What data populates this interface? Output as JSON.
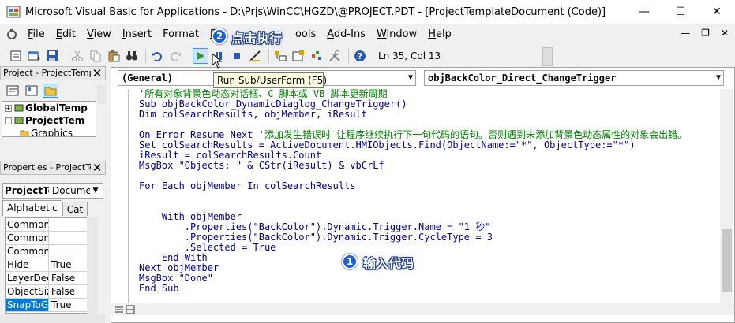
{
  "window": {
    "title": "Microsoft Visual Basic for Applications - D:\\Prjs\\WinCC\\HGZD\\@PROJECT.PDT - [ProjectTemplateDocument (Code)]",
    "minimize": "—",
    "maximize": "☐",
    "close": "✕"
  },
  "menu": {
    "items": [
      {
        "key": "F",
        "rest": "ile"
      },
      {
        "key": "E",
        "rest": "dit"
      },
      {
        "key": "V",
        "rest": "iew"
      },
      {
        "key": "I",
        "rest": "nsert"
      },
      {
        "key": "",
        "rest": "Format"
      },
      {
        "key": "D",
        "rest": ""
      },
      {
        "key": "T",
        "rest": "ools"
      },
      {
        "key": "A",
        "rest": "dd-Ins"
      },
      {
        "key": "W",
        "rest": "indow"
      },
      {
        "key": "H",
        "rest": "elp"
      }
    ],
    "mdi_minimize": "—",
    "mdi_restore": "❐",
    "mdi_close": "✕"
  },
  "toolbar": {
    "position": "Ln 35, Col 13",
    "run_tooltip": "Run Sub/UserForm (F5)"
  },
  "project_panel": {
    "title": "Project - ProjectTemp",
    "close": "✕",
    "tree": [
      {
        "expander": "+",
        "label": "GlobalTemp",
        "bold": true
      },
      {
        "expander": "−",
        "label": "ProjectTem",
        "bold": true
      },
      {
        "expander": "",
        "label": "Graphics",
        "bold": false
      }
    ]
  },
  "properties_panel": {
    "title": "Properties - ProjectTe",
    "close": "✕",
    "object_name": "ProjectTe",
    "object_type": "Documen",
    "tabs": [
      "Alphabetic",
      "Cat"
    ],
    "rows": [
      {
        "name": "CommonV",
        "value": ""
      },
      {
        "name": "CommonV",
        "value": ""
      },
      {
        "name": "CommonV",
        "value": ""
      },
      {
        "name": "Hide",
        "value": "True"
      },
      {
        "name": "LayerDecl",
        "value": "False"
      },
      {
        "name": "ObjectSiz",
        "value": "False"
      },
      {
        "name": "SnapToG",
        "value": "True"
      }
    ]
  },
  "code_window": {
    "object_combo": "(General)",
    "proc_combo": "objBackColor_Direct_ChangeTrigger",
    "lines": [
      {
        "text": "'所有对象背景色动态对话框、C 脚本或 VB 脚本更新周期",
        "kind": "comment"
      },
      {
        "text": "Sub objBackColor_DynamicDiaglog_ChangeTrigger()",
        "kind": "navy"
      },
      {
        "text": "Dim colSearchResults, objMember, iResult",
        "kind": "navy"
      },
      {
        "text": "",
        "kind": "navy"
      },
      {
        "text": "On Error Resume Next '添加发生错误时 让程序继续执行下一句代码的语句。否则遇到未添加背景色动态属性的对象会出错。",
        "kind": "mixed",
        "code": "On Error Resume Next ",
        "comment": "'添加发生错误时 让程序继续执行下一句代码的语句。否则遇到未添加背景色动态属性的对象会出错。"
      },
      {
        "text": "Set colSearchResults = ActiveDocument.HMIObjects.Find(ObjectName:=\"*\", ObjectType:=\"*\")",
        "kind": "navy"
      },
      {
        "text": "iResult = colSearchResults.Count",
        "kind": "navy"
      },
      {
        "text": "MsgBox \"Objects: \" & CStr(iResult) & vbCrLf",
        "kind": "navy"
      },
      {
        "text": "",
        "kind": "navy"
      },
      {
        "text": "For Each objMember In colSearchResults",
        "kind": "navy"
      },
      {
        "text": "",
        "kind": "navy"
      },
      {
        "text": "",
        "kind": "navy"
      },
      {
        "text": "    With objMember",
        "kind": "navy"
      },
      {
        "text": "        .Properties(\"BackColor\").Dynamic.Trigger.Name = \"1 秒\"",
        "kind": "navy"
      },
      {
        "text": "        .Properties(\"BackColor\").Dynamic.Trigger.CycleType = 3",
        "kind": "navy"
      },
      {
        "text": "        .Selected = True",
        "kind": "navy"
      },
      {
        "text": "    End With",
        "kind": "navy"
      },
      {
        "text": "Next objMember",
        "kind": "navy"
      },
      {
        "text": "MsgBox \"Done\"",
        "kind": "navy"
      },
      {
        "text": "End Sub",
        "kind": "navy"
      }
    ]
  },
  "callouts": [
    {
      "number": "2",
      "text": "点击执行"
    },
    {
      "number": "1",
      "text": "输入代码"
    }
  ],
  "colors": {
    "comment": "#008000",
    "code": "#00008b",
    "badge": "#1f5fd6",
    "selection": "#0078d7",
    "tooltip_bg": "#ffffe1"
  }
}
